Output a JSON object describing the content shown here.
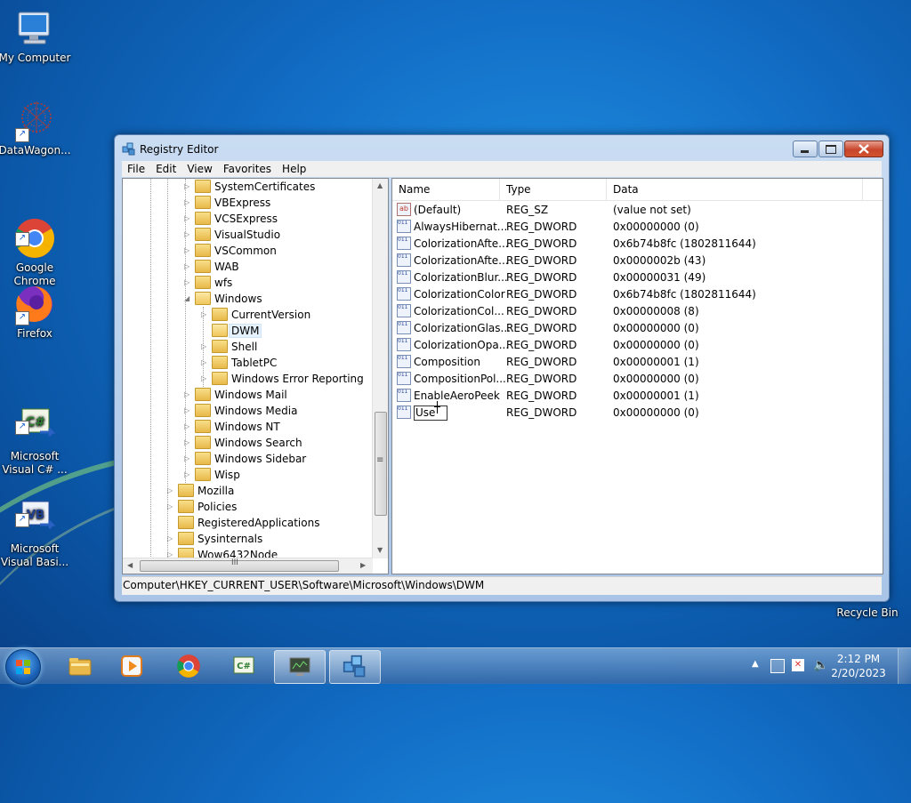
{
  "desktop": {
    "icons": [
      {
        "label": "My Computer",
        "icon": "computer-icon"
      },
      {
        "label": "DataWagon...",
        "icon": "datawagon-icon"
      },
      {
        "label": "Google\nChrome",
        "icon": "chrome-icon"
      },
      {
        "label": "Firefox",
        "icon": "firefox-icon"
      },
      {
        "label": "Microsoft\nVisual C# ...",
        "icon": "visual-csharp-icon"
      },
      {
        "label": "Microsoft\nVisual Basi...",
        "icon": "visual-basic-icon"
      },
      {
        "label": "Recycle Bin",
        "icon": "recycle-bin-icon"
      }
    ]
  },
  "window": {
    "title": "Registry Editor",
    "menu": [
      "File",
      "Edit",
      "View",
      "Favorites",
      "Help"
    ],
    "tree": [
      {
        "label": "SystemCertificates",
        "level": 4,
        "expander": "collapsed"
      },
      {
        "label": "VBExpress",
        "level": 4,
        "expander": "collapsed"
      },
      {
        "label": "VCSExpress",
        "level": 4,
        "expander": "collapsed"
      },
      {
        "label": "VisualStudio",
        "level": 4,
        "expander": "collapsed"
      },
      {
        "label": "VSCommon",
        "level": 4,
        "expander": "collapsed"
      },
      {
        "label": "WAB",
        "level": 4,
        "expander": "collapsed"
      },
      {
        "label": "wfs",
        "level": 4,
        "expander": "collapsed"
      },
      {
        "label": "Windows",
        "level": 4,
        "expander": "expanded"
      },
      {
        "label": "CurrentVersion",
        "level": 5,
        "expander": "collapsed"
      },
      {
        "label": "DWM",
        "level": 5,
        "expander": "none",
        "selected": true
      },
      {
        "label": "Shell",
        "level": 5,
        "expander": "collapsed"
      },
      {
        "label": "TabletPC",
        "level": 5,
        "expander": "collapsed"
      },
      {
        "label": "Windows Error Reporting",
        "level": 5,
        "expander": "collapsed"
      },
      {
        "label": "Windows Mail",
        "level": 4,
        "expander": "collapsed"
      },
      {
        "label": "Windows Media",
        "level": 4,
        "expander": "collapsed"
      },
      {
        "label": "Windows NT",
        "level": 4,
        "expander": "collapsed"
      },
      {
        "label": "Windows Search",
        "level": 4,
        "expander": "collapsed"
      },
      {
        "label": "Windows Sidebar",
        "level": 4,
        "expander": "collapsed"
      },
      {
        "label": "Wisp",
        "level": 4,
        "expander": "collapsed"
      },
      {
        "label": "Mozilla",
        "level": 3,
        "expander": "collapsed"
      },
      {
        "label": "Policies",
        "level": 3,
        "expander": "collapsed"
      },
      {
        "label": "RegisteredApplications",
        "level": 3,
        "expander": "none"
      },
      {
        "label": "Sysinternals",
        "level": 3,
        "expander": "collapsed"
      },
      {
        "label": "Wow6432Node",
        "level": 3,
        "expander": "collapsed"
      }
    ],
    "columns": [
      "Name",
      "Type",
      "Data"
    ],
    "values": [
      {
        "name": "(Default)",
        "type": "REG_SZ",
        "data": "(value not set)",
        "icon": "string-value-icon"
      },
      {
        "name": "AlwaysHibernat...",
        "type": "REG_DWORD",
        "data": "0x00000000 (0)",
        "icon": "dword-value-icon"
      },
      {
        "name": "ColorizationAfte...",
        "type": "REG_DWORD",
        "data": "0x6b74b8fc (1802811644)",
        "icon": "dword-value-icon"
      },
      {
        "name": "ColorizationAfte...",
        "type": "REG_DWORD",
        "data": "0x0000002b (43)",
        "icon": "dword-value-icon"
      },
      {
        "name": "ColorizationBlur...",
        "type": "REG_DWORD",
        "data": "0x00000031 (49)",
        "icon": "dword-value-icon"
      },
      {
        "name": "ColorizationColor",
        "type": "REG_DWORD",
        "data": "0x6b74b8fc (1802811644)",
        "icon": "dword-value-icon"
      },
      {
        "name": "ColorizationCol...",
        "type": "REG_DWORD",
        "data": "0x00000008 (8)",
        "icon": "dword-value-icon"
      },
      {
        "name": "ColorizationGlas...",
        "type": "REG_DWORD",
        "data": "0x00000000 (0)",
        "icon": "dword-value-icon"
      },
      {
        "name": "ColorizationOpa...",
        "type": "REG_DWORD",
        "data": "0x00000000 (0)",
        "icon": "dword-value-icon"
      },
      {
        "name": "Composition",
        "type": "REG_DWORD",
        "data": "0x00000001 (1)",
        "icon": "dword-value-icon"
      },
      {
        "name": "CompositionPol...",
        "type": "REG_DWORD",
        "data": "0x00000000 (0)",
        "icon": "dword-value-icon"
      },
      {
        "name": "EnableAeroPeek",
        "type": "REG_DWORD",
        "data": "0x00000001 (1)",
        "icon": "dword-value-icon"
      },
      {
        "name": "Use",
        "type": "REG_DWORD",
        "data": "0x00000000 (0)",
        "icon": "dword-value-icon",
        "editing": true
      }
    ],
    "status_path": "Computer\\HKEY_CURRENT_USER\\Software\\Microsoft\\Windows\\DWM",
    "hscroll_grip": "III",
    "vscroll_grip": "≡"
  },
  "taskbar": {
    "buttons": [
      {
        "name": "explorer",
        "icon": "folder-icon",
        "active": false
      },
      {
        "name": "media-player",
        "icon": "media-player-icon",
        "active": false
      },
      {
        "name": "chrome",
        "icon": "chrome-icon",
        "active": false
      },
      {
        "name": "visual-csharp",
        "icon": "visual-csharp-icon",
        "active": false
      },
      {
        "name": "network-app",
        "icon": "monitor-icon",
        "active": true
      },
      {
        "name": "registry-editor",
        "icon": "regedit-icon",
        "active": true
      }
    ],
    "clock_time": "2:12 PM",
    "clock_date": "2/20/2023"
  }
}
